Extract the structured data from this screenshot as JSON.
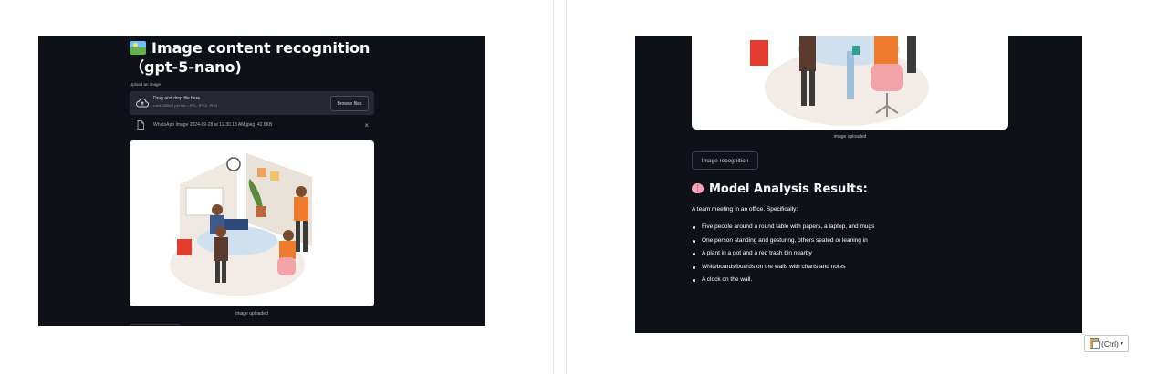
{
  "left": {
    "title": "Image content recognition（gpt-5-nano)",
    "upload_label": "Upload an image",
    "dropzone": {
      "text": "Drag and drop file here",
      "limit": "Limit 200MB per file • JPG, JPEG, PNG",
      "browse_label": "Browse files"
    },
    "file": {
      "name": "WhatsApp Image 2024-09-28 at 12.30.13 AM.jpeg",
      "size": "42.6KB",
      "close": "×"
    },
    "caption": "image uploaded"
  },
  "right": {
    "caption": "image uploaded",
    "recognize_button": "Image recognition",
    "results_title": "Model Analysis Results:",
    "intro": "A team meeting in an office. Specifically:",
    "items": [
      "Five people around a round table with papers, a laptop, and mugs",
      "One person standing and gesturing, others seated or leaning in",
      "A plant in a pot and a red trash bin nearby",
      "Whiteboards/boards on the walls with charts and notes",
      "A clock on the wall."
    ]
  },
  "paste_options": {
    "label": "(Ctrl)"
  },
  "colors": {
    "app_background": "#0e1117",
    "dropzone": "#262730",
    "page": "#ffffff"
  }
}
